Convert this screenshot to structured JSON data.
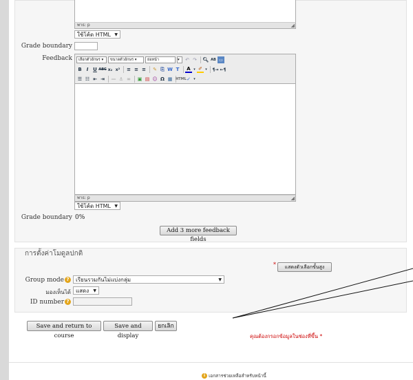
{
  "editor1": {
    "path_label": "พาธ: p",
    "format_select": "ใช้โค้ด HTML"
  },
  "grade_boundary_1": {
    "label": "Grade boundary",
    "value": ""
  },
  "feedback": {
    "label": "Feedback",
    "toolbar": {
      "font_family": "เลือกตัวอักษร",
      "font_size": "ขนาดตัวอักษร",
      "format": "ย่อหน้า",
      "row1_buttons": [
        "undo-icon",
        "redo-icon",
        "find-icon",
        "replace-icon",
        "fullscreen-icon"
      ],
      "row2_buttons": [
        "B",
        "I",
        "U",
        "ABC",
        "x₂",
        "x²",
        "align-left-icon",
        "align-center-icon",
        "align-right-icon",
        "clean-icon",
        "paste-icon",
        "paste-word-icon",
        "paste-text-icon",
        "A",
        "highlight-icon",
        "ltr-icon",
        "rtl-icon"
      ],
      "row3_buttons": [
        "bullet-list-icon",
        "number-list-icon",
        "outdent-icon",
        "indent-icon",
        "hr-icon",
        "anchor-icon",
        "unlink-icon",
        "image-icon",
        "movie-icon",
        "emoticon-icon",
        "omega-icon",
        "table-icon",
        "html-icon",
        "spell-icon"
      ]
    },
    "path_label": "พาธ: p",
    "format_select": "ใช้โค้ด HTML"
  },
  "grade_boundary_2": {
    "label": "Grade boundary",
    "value": "0%"
  },
  "add_feedback_button": "Add 3 more feedback fields",
  "common_settings": {
    "legend": "การตั้งค่าโมดูลปกติ",
    "show_advanced": "แสดงตัวเลือกขั้นสูง",
    "group_mode_label": "Group mode",
    "group_mode_value": "เรียนรวมกันไม่แบ่งกลุ่ม",
    "visible_label": "มองเห็นได้",
    "visible_value": "แสดง",
    "id_number_label": "ID number",
    "id_number_value": ""
  },
  "buttons": {
    "save_return": "Save and return to course",
    "save_display": "Save and display",
    "cancel": "ยกเลิก"
  },
  "required_note": "คุณต้องกรอกข้อมูลในช่องที่ขึ้น",
  "required_star": "*",
  "footer_help": "เอกสารช่วยเหลือสำหรับหน้านี้",
  "colors": {
    "required": "#cc0000",
    "help_icon": "#e3a51b"
  }
}
